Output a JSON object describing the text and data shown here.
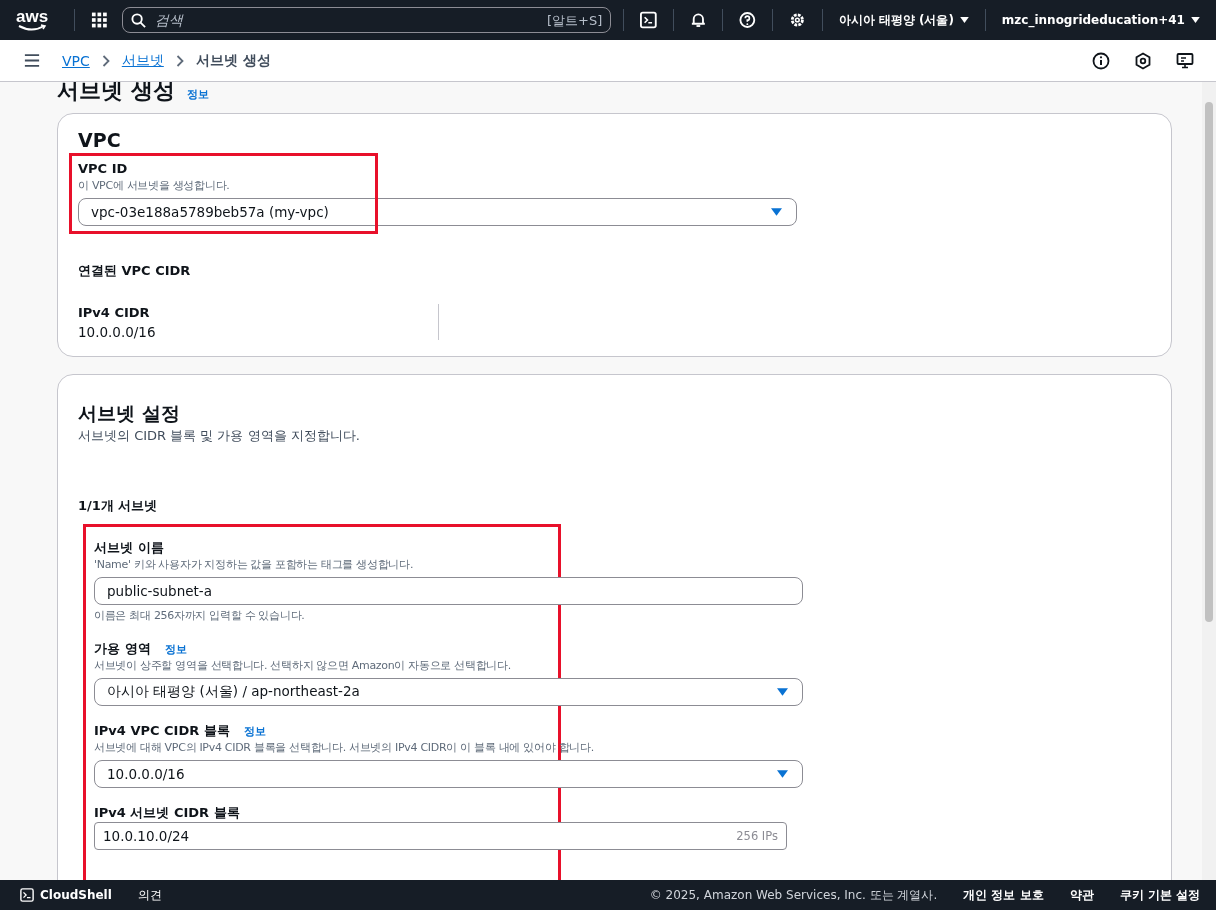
{
  "top_nav": {
    "logo": "aws",
    "search_placeholder": "검색",
    "search_shortcut": "[알트+S]",
    "region": "아시아 태평양 (서울)",
    "account": "mzc_innogrideducation+41"
  },
  "breadcrumbs": [
    {
      "label": "VPC",
      "link": true
    },
    {
      "label": "서브넷",
      "link": true
    },
    {
      "label": "서브넷 생성",
      "link": false
    }
  ],
  "page": {
    "title": "서브넷 생성",
    "info_link": "정보"
  },
  "vpc_section": {
    "title": "VPC",
    "vpc_id_label": "VPC ID",
    "vpc_id_description": "이 VPC에 서브넷을 생성합니다.",
    "vpc_id_value": "vpc-03e188a5789beb57a (my-vpc)",
    "cidr_heading": "연결된 VPC CIDR",
    "cidr_label": "IPv4 CIDR",
    "cidr_value": "10.0.0.0/16"
  },
  "subnet_section": {
    "title": "서브넷 설정",
    "description": "서브넷의 CIDR 블록 및 가용 영역을 지정합니다.",
    "count_label": "1/1개 서브넷",
    "fields": [
      {
        "kind": "text",
        "label": "서브넷 이름",
        "description": "'Name' 키와 사용자가 지정하는 값을 포함하는 태그를 생성합니다.",
        "value": "public-subnet-a",
        "hint": "이름은 최대 256자까지 입력할 수 있습니다."
      },
      {
        "kind": "select",
        "label": "가용 영역",
        "info": "정보",
        "description": "서브넷이 상주할 영역을 선택합니다. 선택하지 않으면 Amazon이 자동으로 선택합니다.",
        "value": "아시아 태평양 (서울) / ap-northeast-2a"
      },
      {
        "kind": "select",
        "label": "IPv4 VPC CIDR 블록",
        "info": "정보",
        "description": "서브넷에 대해 VPC의 IPv4 CIDR 블록을 선택합니다. 서브넷의 IPv4 CIDR이 이 블록 내에 있어야 합니다.",
        "value": "10.0.0.0/16"
      },
      {
        "kind": "cidr",
        "label": "IPv4 서브넷 CIDR 블록",
        "value": "10.0.10.0/24",
        "suffix": "256 IPs"
      }
    ]
  },
  "footer": {
    "cloudshell": "CloudShell",
    "feedback": "의견",
    "copyright": "© 2025, Amazon Web Services, Inc. 또는 계열사.",
    "links": [
      "개인 정보 보호",
      "약관",
      "쿠키 기본 설정"
    ]
  }
}
